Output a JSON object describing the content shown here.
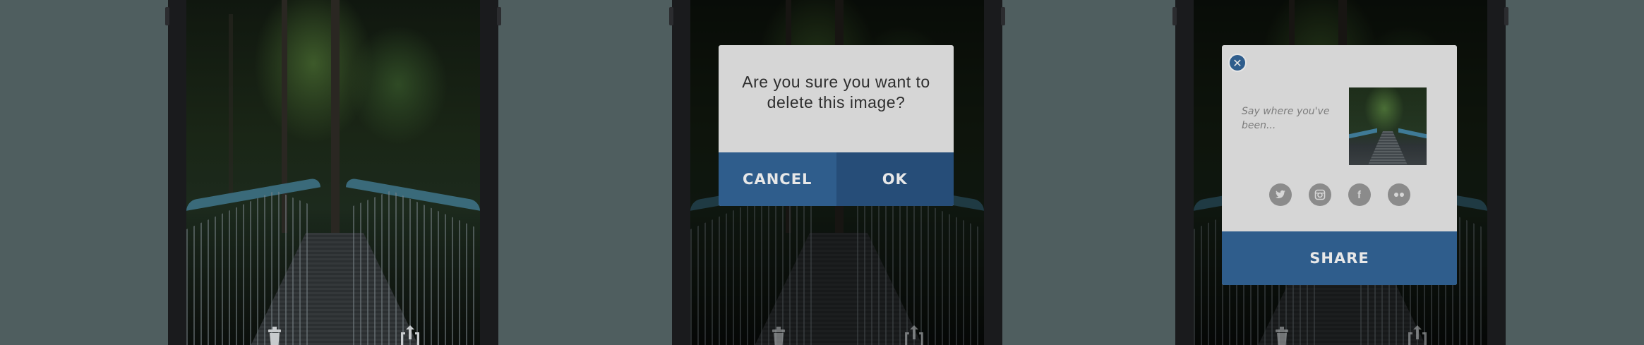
{
  "screens": [
    {
      "name": "photo-view",
      "toolbar": {
        "delete_icon": "trash-icon",
        "share_icon": "share-icon"
      }
    },
    {
      "name": "delete-confirm",
      "dialog": {
        "message_line1": "Are you sure you want to",
        "message_line2": "delete this image?",
        "cancel_label": "CANCEL",
        "ok_label": "OK"
      },
      "toolbar": {
        "delete_icon": "trash-icon",
        "share_icon": "share-icon"
      }
    },
    {
      "name": "share-dialog",
      "share": {
        "close_icon": "close-icon",
        "placeholder": "Say where you've been...",
        "socials": [
          "twitter-icon",
          "instagram-icon",
          "facebook-icon",
          "flickr-icon"
        ],
        "share_label": "SHARE"
      },
      "toolbar": {
        "delete_icon": "trash-icon",
        "share_icon": "share-icon"
      }
    }
  ],
  "colors": {
    "background": "#4f5e5f",
    "accent": "#2f5d8c",
    "dialog": "#d6d6d6"
  }
}
